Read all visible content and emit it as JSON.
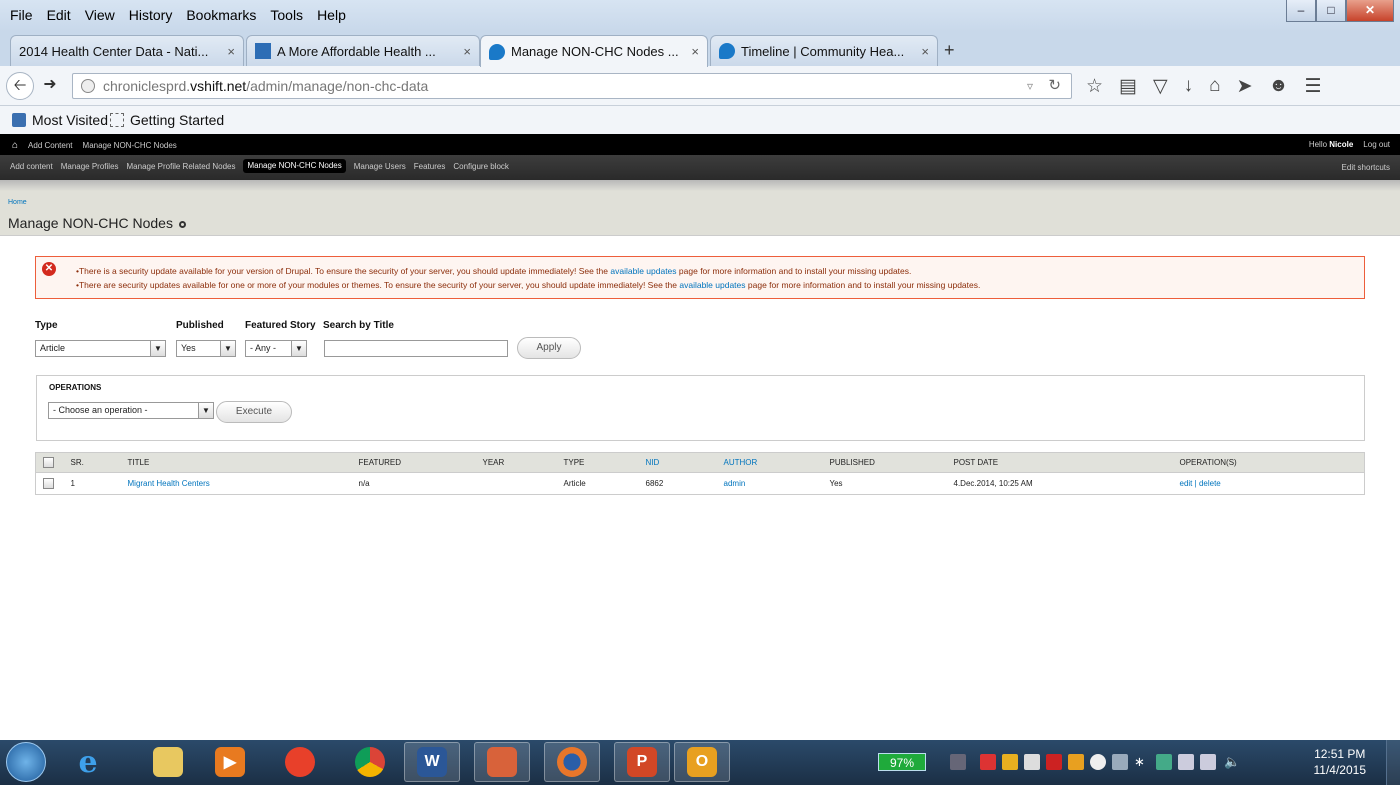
{
  "browser": {
    "menu": [
      "File",
      "Edit",
      "View",
      "History",
      "Bookmarks",
      "Tools",
      "Help"
    ],
    "tabs": [
      {
        "label": "2014 Health Center Data - Nati..."
      },
      {
        "label": "A More Affordable Health ..."
      },
      {
        "label": "Manage NON-CHC Nodes ..."
      },
      {
        "label": "Timeline | Community Hea..."
      }
    ],
    "tab_close": "×",
    "new_tab": "+",
    "url_prefix": "chroniclesprd.",
    "url_domain": "vshift.net",
    "url_path": "/admin/manage/non-chc-data",
    "bookmarks": [
      "Most Visited",
      "Getting Started"
    ]
  },
  "toolbar": {
    "shortcuts": [
      "Add Content",
      "Manage NON-CHC Nodes"
    ],
    "hello": "Hello",
    "user": "Nicole",
    "logout": "Log out",
    "menu": [
      "Add content",
      "Manage Profiles",
      "Manage Profile Related Nodes",
      "Manage NON-CHC Nodes",
      "Manage Users",
      "Features",
      "Configure block"
    ],
    "edit_shortcuts": "Edit shortcuts"
  },
  "page": {
    "breadcrumb": "Home",
    "title": "Manage NON-CHC Nodes"
  },
  "messages": {
    "line1_before": "There is a security update available for your version of Drupal. To ensure the security of your server, you should update immediately! See the",
    "line1_link": "available updates",
    "line1_after": "page for more information and to install your missing updates.",
    "line2_before": "There are security updates available for one or more of your modules or themes. To ensure the security of your server, you should update immediately! See the",
    "line2_link": "available updates",
    "line2_after": "page for more information and to install your missing updates."
  },
  "filters": {
    "type_label": "Type",
    "type_value": "Article",
    "published_label": "Published",
    "published_value": "Yes",
    "featured_label": "Featured Story",
    "featured_value": "- Any -",
    "search_label": "Search by Title",
    "search_value": "",
    "apply": "Apply"
  },
  "operations": {
    "title": "OPERATIONS",
    "select_value": "- Choose an operation -",
    "execute": "Execute"
  },
  "table": {
    "headers": [
      "SR.",
      "TITLE",
      "FEATURED",
      "YEAR",
      "TYPE",
      "NID",
      "AUTHOR",
      "PUBLISHED",
      "POST DATE",
      "OPERATION(S)"
    ],
    "rows": [
      {
        "sr": "1",
        "title": "Migrant Health Centers",
        "featured": "n/a",
        "year": "",
        "type": "Article",
        "nid": "6862",
        "author": "admin",
        "published": "Yes",
        "post_date": "4.Dec.2014, 10:25 AM",
        "edit": "edit",
        "sep": "|",
        "delete": "delete"
      }
    ]
  },
  "taskbar": {
    "battery": "97%",
    "time": "12:51 PM",
    "date": "11/4/2015"
  },
  "colors": {
    "link": "#0074bd",
    "error_border": "#ed5e3b",
    "error_text": "#8c2e0b"
  }
}
